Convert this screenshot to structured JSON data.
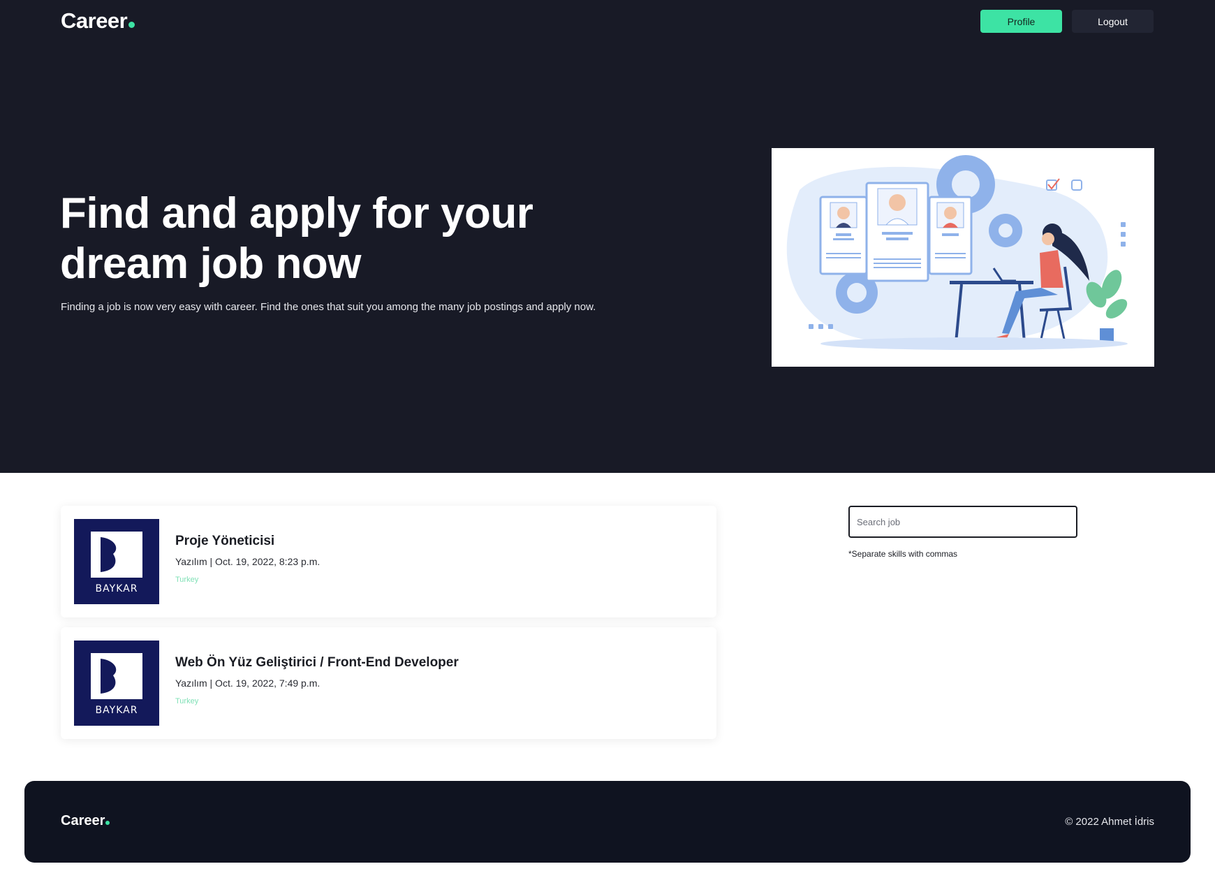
{
  "header": {
    "logo_text": "Career",
    "profile_label": "Profile",
    "logout_label": "Logout"
  },
  "hero": {
    "title": "Find and apply for your dream job now",
    "subtitle": "Finding a job is now very easy with career. Find the ones that suit you among the many job postings and apply now."
  },
  "jobs": [
    {
      "title": "Proje Yöneticisi",
      "meta": "Yazılım | Oct. 19, 2022, 8:23 p.m.",
      "location": "Turkey",
      "company_logo_text": "BAYKAR"
    },
    {
      "title": "Web Ön Yüz Geliştirici / Front-End Developer",
      "meta": "Yazılım | Oct. 19, 2022, 7:49 p.m.",
      "location": "Turkey",
      "company_logo_text": "BAYKAR"
    }
  ],
  "search": {
    "placeholder": "Search job",
    "value": "",
    "hint": "*Separate skills with commas"
  },
  "footer": {
    "logo_text": "Career",
    "copyright": "© 2022 Ahmet İdris"
  },
  "colors": {
    "accent": "#3de3a4",
    "dark": "#181a26",
    "footer": "#0f1320",
    "company_logo_bg": "#13195a"
  }
}
